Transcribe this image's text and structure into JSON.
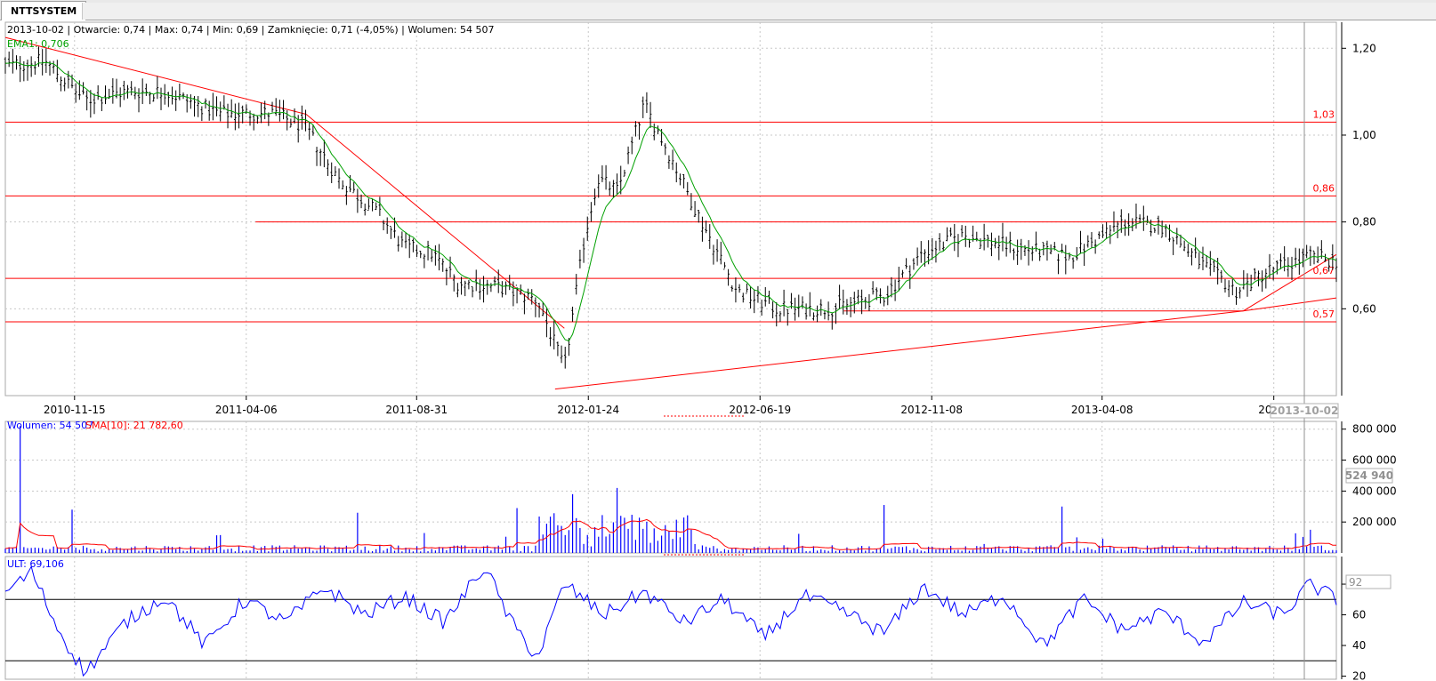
{
  "tab": {
    "title": "NTTSYSTEM"
  },
  "price_panel": {
    "info_text": "2013-10-02 | Otwarcie: 0,74 | Max: 0,74 | Min: 0,69 | Zamknięcie: 0,71 (-4,05%)  | Wolumen: 54 507",
    "ema_label": "EMA1: 0,706",
    "crosshair_date": "2013-10-02"
  },
  "volume_panel": {
    "volume_label": "Wolumen: 54 507",
    "sma_label": "SMA[10]: 21 782,60",
    "crosshair_value": "524 940"
  },
  "ult_panel": {
    "ult_label": "ULT: 69,106",
    "crosshair_value": "92"
  },
  "colors": {
    "grid": "#c8c8c8",
    "candle": "#000000",
    "ema": "#00a000",
    "level_line": "#ff0000",
    "volume_bar": "#0000ff",
    "sma": "#ff0000",
    "ult": "#0000ff"
  },
  "chart_data": [
    {
      "type": "candlestick",
      "xaxis_ticks": [
        "2010-11-15",
        "2011-04-06",
        "2011-08-31",
        "2012-01-24",
        "2012-06-19",
        "2012-11-08",
        "2013-04-08",
        "2013-"
      ],
      "yaxis_ticks": [
        "0,60",
        "0,80",
        "1,00",
        "1,20"
      ],
      "ylim": [
        0.4,
        1.26
      ],
      "horizontal_levels": [
        {
          "value": 1.03,
          "label": "1,03"
        },
        {
          "value": 0.86,
          "label": "0,86"
        },
        {
          "value": 0.8,
          "label": ""
        },
        {
          "value": 0.67,
          "label": "0,67"
        },
        {
          "value": 0.57,
          "label": "0,57"
        }
      ],
      "price_anchor_points": [
        {
          "t": 0.0,
          "p": 1.16
        },
        {
          "t": 0.03,
          "p": 1.17
        },
        {
          "t": 0.06,
          "p": 1.08
        },
        {
          "t": 0.09,
          "p": 1.1
        },
        {
          "t": 0.12,
          "p": 1.1
        },
        {
          "t": 0.16,
          "p": 1.05
        },
        {
          "t": 0.2,
          "p": 1.05
        },
        {
          "t": 0.225,
          "p": 1.02
        },
        {
          "t": 0.25,
          "p": 0.9
        },
        {
          "t": 0.28,
          "p": 0.82
        },
        {
          "t": 0.3,
          "p": 0.74
        },
        {
          "t": 0.32,
          "p": 0.73
        },
        {
          "t": 0.34,
          "p": 0.66
        },
        {
          "t": 0.37,
          "p": 0.65
        },
        {
          "t": 0.4,
          "p": 0.62
        },
        {
          "t": 0.42,
          "p": 0.46
        },
        {
          "t": 0.435,
          "p": 0.76
        },
        {
          "t": 0.445,
          "p": 0.9
        },
        {
          "t": 0.46,
          "p": 0.87
        },
        {
          "t": 0.48,
          "p": 1.07
        },
        {
          "t": 0.5,
          "p": 0.95
        },
        {
          "t": 0.52,
          "p": 0.82
        },
        {
          "t": 0.55,
          "p": 0.64
        },
        {
          "t": 0.58,
          "p": 0.6
        },
        {
          "t": 0.62,
          "p": 0.6
        },
        {
          "t": 0.66,
          "p": 0.63
        },
        {
          "t": 0.69,
          "p": 0.73
        },
        {
          "t": 0.72,
          "p": 0.77
        },
        {
          "t": 0.76,
          "p": 0.74
        },
        {
          "t": 0.8,
          "p": 0.72
        },
        {
          "t": 0.84,
          "p": 0.8
        },
        {
          "t": 0.87,
          "p": 0.79
        },
        {
          "t": 0.9,
          "p": 0.7
        },
        {
          "t": 0.925,
          "p": 0.64
        },
        {
          "t": 0.95,
          "p": 0.69
        },
        {
          "t": 0.98,
          "p": 0.72
        },
        {
          "t": 1.0,
          "p": 0.71
        }
      ]
    },
    {
      "type": "bar",
      "yaxis_ticks": [
        "200 000",
        "400 000",
        "600 000",
        "800 000"
      ],
      "ylim": [
        0,
        850000
      ],
      "spike_points": [
        {
          "t": 0.012,
          "v": 820000
        },
        {
          "t": 0.051,
          "v": 280000
        },
        {
          "t": 0.265,
          "v": 260000
        },
        {
          "t": 0.385,
          "v": 290000
        },
        {
          "t": 0.425,
          "v": 380000
        },
        {
          "t": 0.46,
          "v": 420000
        },
        {
          "t": 0.66,
          "v": 310000
        },
        {
          "t": 0.795,
          "v": 300000
        },
        {
          "t": 0.98,
          "v": 150000
        }
      ]
    },
    {
      "type": "line",
      "yaxis_ticks": [
        "20",
        "40",
        "60",
        "80"
      ],
      "ylim": [
        18,
        98
      ],
      "reference_levels": [
        30,
        70
      ],
      "anchor_points": [
        {
          "t": 0.0,
          "v": 75
        },
        {
          "t": 0.02,
          "v": 88
        },
        {
          "t": 0.04,
          "v": 50
        },
        {
          "t": 0.06,
          "v": 22
        },
        {
          "t": 0.09,
          "v": 55
        },
        {
          "t": 0.12,
          "v": 72
        },
        {
          "t": 0.15,
          "v": 40
        },
        {
          "t": 0.18,
          "v": 70
        },
        {
          "t": 0.21,
          "v": 55
        },
        {
          "t": 0.24,
          "v": 78
        },
        {
          "t": 0.27,
          "v": 60
        },
        {
          "t": 0.3,
          "v": 72
        },
        {
          "t": 0.33,
          "v": 55
        },
        {
          "t": 0.36,
          "v": 92
        },
        {
          "t": 0.38,
          "v": 55
        },
        {
          "t": 0.4,
          "v": 32
        },
        {
          "t": 0.42,
          "v": 80
        },
        {
          "t": 0.45,
          "v": 60
        },
        {
          "t": 0.48,
          "v": 75
        },
        {
          "t": 0.51,
          "v": 55
        },
        {
          "t": 0.54,
          "v": 70
        },
        {
          "t": 0.57,
          "v": 45
        },
        {
          "t": 0.6,
          "v": 72
        },
        {
          "t": 0.63,
          "v": 62
        },
        {
          "t": 0.66,
          "v": 48
        },
        {
          "t": 0.69,
          "v": 78
        },
        {
          "t": 0.72,
          "v": 60
        },
        {
          "t": 0.75,
          "v": 73
        },
        {
          "t": 0.78,
          "v": 40
        },
        {
          "t": 0.81,
          "v": 70
        },
        {
          "t": 0.84,
          "v": 50
        },
        {
          "t": 0.87,
          "v": 62
        },
        {
          "t": 0.9,
          "v": 42
        },
        {
          "t": 0.93,
          "v": 68
        },
        {
          "t": 0.96,
          "v": 60
        },
        {
          "t": 0.98,
          "v": 80
        },
        {
          "t": 1.0,
          "v": 70
        }
      ]
    }
  ]
}
